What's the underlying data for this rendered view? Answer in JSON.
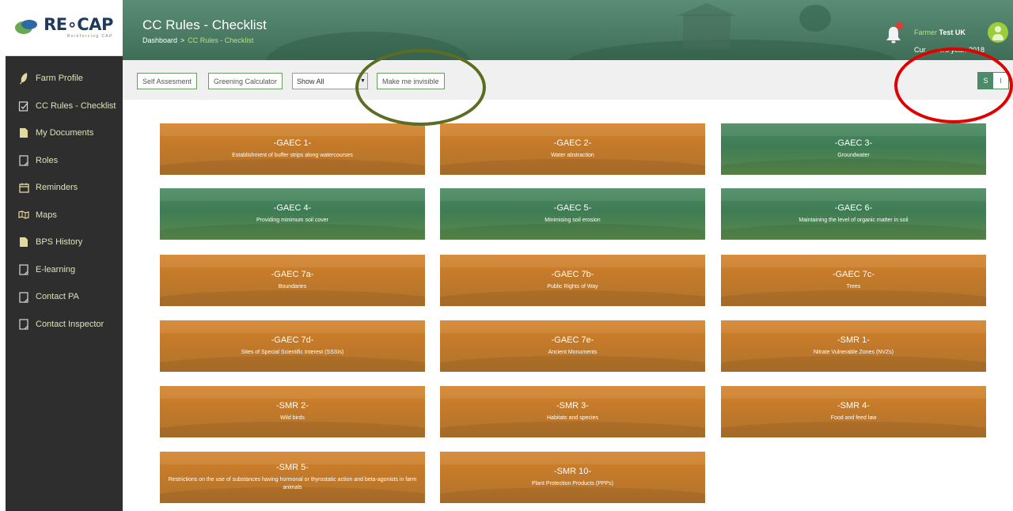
{
  "colors": {
    "sidebar_bg": "#2e2e2e",
    "menu_text": "#d8e3b8",
    "header_bg": "#4a7a63",
    "accent_green": "#4c8a69",
    "card_orange": "#c47a2a",
    "card_green": "#3f7c55",
    "annotation_green": "#5b6c23",
    "annotation_red": "#e00000"
  },
  "app": {
    "logo_name": "RE∘CAP",
    "logo_sub": "Reinforcing CAP"
  },
  "sidebar": {
    "items": [
      {
        "label": "Farm Profile",
        "icon": "leaf-icon"
      },
      {
        "label": "CC Rules - Checklist",
        "icon": "checklist-icon"
      },
      {
        "label": "My Documents",
        "icon": "document-icon"
      },
      {
        "label": "Roles",
        "icon": "clipboard-icon"
      },
      {
        "label": "Reminders",
        "icon": "calendar-icon"
      },
      {
        "label": "Maps",
        "icon": "map-icon"
      },
      {
        "label": "BPS History",
        "icon": "document-icon"
      },
      {
        "label": "E-learning",
        "icon": "clipboard-icon"
      },
      {
        "label": "Contact PA",
        "icon": "clipboard-icon"
      },
      {
        "label": "Contact Inspector",
        "icon": "clipboard-icon"
      }
    ]
  },
  "header": {
    "title": "CC Rules - Checklist",
    "breadcrumb": {
      "root": "Dashboard",
      "separator": ">",
      "current": "CC Rules - Checklist"
    },
    "notification_count": "1",
    "user_prefix": "Farmer",
    "user_name": "Test UK",
    "current_year_label": "Cur...   ...ers year: 2018"
  },
  "toolbar": {
    "self_assessment": "Self Assesment",
    "greening_calculator": "Greening Calculator",
    "filter_value": "Show All",
    "make_invisible": "Make me invisible",
    "view_s": "S",
    "view_i": "I"
  },
  "cards": [
    {
      "code": "-GAEC 1-",
      "desc": "Establishment of buffer strips along watercourses",
      "status": "orange"
    },
    {
      "code": "-GAEC 2-",
      "desc": "Water abstraction",
      "status": "orange"
    },
    {
      "code": "-GAEC 3-",
      "desc": "Groundwater",
      "status": "green"
    },
    {
      "code": "-GAEC 4-",
      "desc": "Providing minimum soil cover",
      "status": "green"
    },
    {
      "code": "-GAEC 5-",
      "desc": "Minimising soil erosion",
      "status": "green"
    },
    {
      "code": "-GAEC 6-",
      "desc": "Maintaining the level of organic matter in soil",
      "status": "green"
    },
    {
      "code": "-GAEC 7a-",
      "desc": "Boundaries",
      "status": "orange"
    },
    {
      "code": "-GAEC 7b-",
      "desc": "Public Rights of Way",
      "status": "orange"
    },
    {
      "code": "-GAEC 7c-",
      "desc": "Trees",
      "status": "orange"
    },
    {
      "code": "-GAEC 7d-",
      "desc": "Sites of Special Scientific Interest (SSSIs)",
      "status": "orange"
    },
    {
      "code": "-GAEC 7e-",
      "desc": "Ancient Monuments",
      "status": "orange"
    },
    {
      "code": "-SMR 1-",
      "desc": "Nitrate Vulnerable Zones (NVZs)",
      "status": "orange"
    },
    {
      "code": "-SMR 2-",
      "desc": "Wild birds",
      "status": "orange"
    },
    {
      "code": "-SMR 3-",
      "desc": "Habitats and species",
      "status": "orange"
    },
    {
      "code": "-SMR 4-",
      "desc": "Food and feed law",
      "status": "orange"
    },
    {
      "code": "-SMR 5-",
      "desc": "Restrictions on the use of substances having hormonal or thyrostatic action and beta-agonists in farm animals",
      "status": "orange"
    },
    {
      "code": "-SMR 10-",
      "desc": "Plant Protection Products (PPPs)",
      "status": "orange"
    }
  ]
}
